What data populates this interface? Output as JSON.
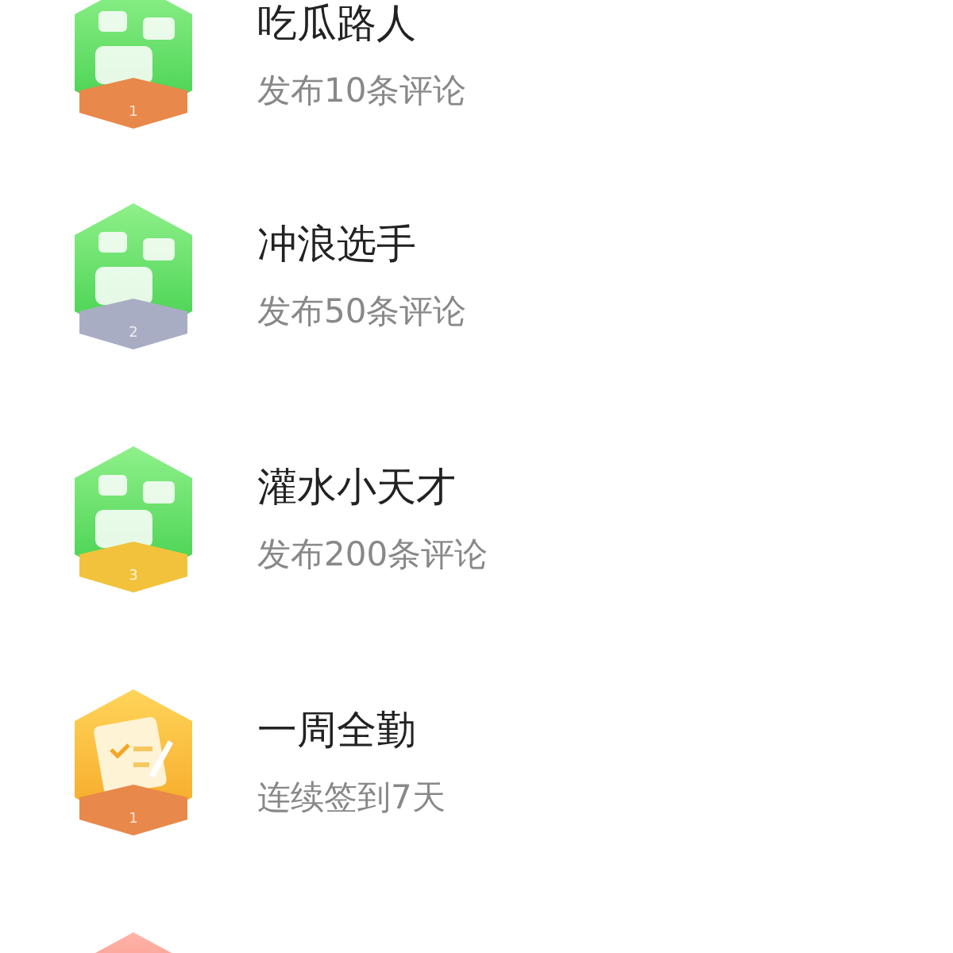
{
  "achievements": [
    {
      "kind": "comment",
      "color": "#e8884a",
      "rank": "1",
      "title": "吃瓜路人",
      "subtitle": "发布10条评论"
    },
    {
      "kind": "comment",
      "color": "#a9adc4",
      "rank": "2",
      "title": "冲浪选手",
      "subtitle": "发布50条评论"
    },
    {
      "kind": "comment",
      "color": "#f2c23c",
      "rank": "3",
      "title": "灌水小天才",
      "subtitle": "发布200条评论"
    },
    {
      "kind": "checkin",
      "color": "#e8884a",
      "rank": "1",
      "title": "一周全勤",
      "subtitle": "连续签到7天"
    },
    {
      "kind": "red"
    }
  ]
}
